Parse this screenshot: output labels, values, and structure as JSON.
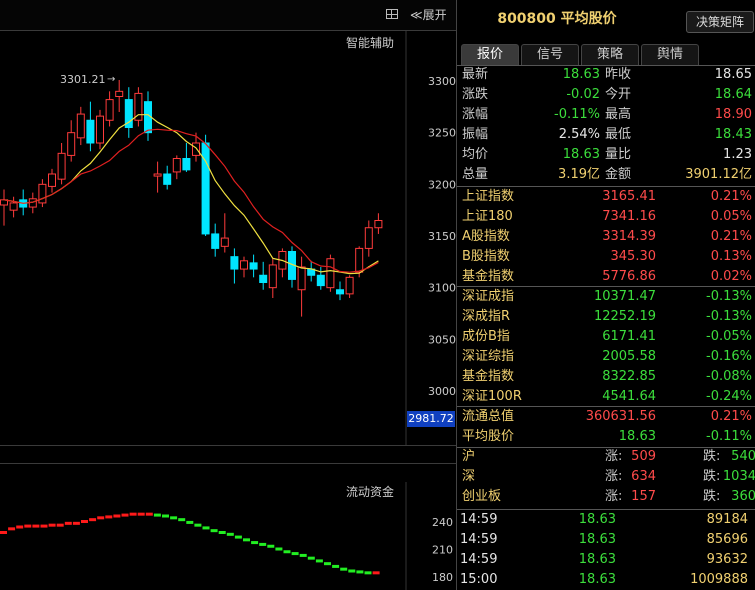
{
  "toolbar": {
    "expand_label": "≪展开"
  },
  "kline": {
    "indicator_label": "智能辅助",
    "high_label": "3301.21",
    "price_marker": "2981.72",
    "y_ticks": [
      "3300",
      "3250",
      "3200",
      "3150",
      "3100",
      "3050",
      "3000"
    ],
    "candles": [
      {
        "o": 3180,
        "h": 3195,
        "l": 3160,
        "c": 3185
      },
      {
        "o": 3175,
        "h": 3188,
        "l": 3168,
        "c": 3182
      },
      {
        "o": 3185,
        "h": 3195,
        "l": 3170,
        "c": 3178
      },
      {
        "o": 3178,
        "h": 3192,
        "l": 3172,
        "c": 3186
      },
      {
        "o": 3182,
        "h": 3205,
        "l": 3178,
        "c": 3200
      },
      {
        "o": 3198,
        "h": 3215,
        "l": 3192,
        "c": 3210
      },
      {
        "o": 3205,
        "h": 3240,
        "l": 3200,
        "c": 3230
      },
      {
        "o": 3228,
        "h": 3262,
        "l": 3222,
        "c": 3250
      },
      {
        "o": 3245,
        "h": 3275,
        "l": 3238,
        "c": 3268
      },
      {
        "o": 3262,
        "h": 3280,
        "l": 3232,
        "c": 3240
      },
      {
        "o": 3240,
        "h": 3272,
        "l": 3234,
        "c": 3266
      },
      {
        "o": 3262,
        "h": 3290,
        "l": 3256,
        "c": 3282
      },
      {
        "o": 3285,
        "h": 3301,
        "l": 3270,
        "c": 3290
      },
      {
        "o": 3282,
        "h": 3294,
        "l": 3245,
        "c": 3255
      },
      {
        "o": 3262,
        "h": 3294,
        "l": 3256,
        "c": 3288
      },
      {
        "o": 3280,
        "h": 3290,
        "l": 3242,
        "c": 3250
      },
      {
        "o": 3208,
        "h": 3222,
        "l": 3192,
        "c": 3210
      },
      {
        "o": 3210,
        "h": 3218,
        "l": 3195,
        "c": 3200
      },
      {
        "o": 3212,
        "h": 3228,
        "l": 3205,
        "c": 3225
      },
      {
        "o": 3225,
        "h": 3240,
        "l": 3212,
        "c": 3214
      },
      {
        "o": 3228,
        "h": 3250,
        "l": 3222,
        "c": 3240
      },
      {
        "o": 3240,
        "h": 3248,
        "l": 3150,
        "c": 3152
      },
      {
        "o": 3152,
        "h": 3162,
        "l": 3130,
        "c": 3138
      },
      {
        "o": 3140,
        "h": 3172,
        "l": 3134,
        "c": 3148
      },
      {
        "o": 3130,
        "h": 3138,
        "l": 3104,
        "c": 3118
      },
      {
        "o": 3118,
        "h": 3130,
        "l": 3110,
        "c": 3126
      },
      {
        "o": 3124,
        "h": 3132,
        "l": 3110,
        "c": 3118
      },
      {
        "o": 3112,
        "h": 3125,
        "l": 3098,
        "c": 3105
      },
      {
        "o": 3100,
        "h": 3128,
        "l": 3090,
        "c": 3122
      },
      {
        "o": 3118,
        "h": 3138,
        "l": 3110,
        "c": 3135
      },
      {
        "o": 3135,
        "h": 3140,
        "l": 3100,
        "c": 3108
      },
      {
        "o": 3098,
        "h": 3130,
        "l": 3072,
        "c": 3120
      },
      {
        "o": 3118,
        "h": 3126,
        "l": 3106,
        "c": 3112
      },
      {
        "o": 3112,
        "h": 3120,
        "l": 3098,
        "c": 3102
      },
      {
        "o": 3100,
        "h": 3132,
        "l": 3096,
        "c": 3128
      },
      {
        "o": 3098,
        "h": 3106,
        "l": 3088,
        "c": 3094
      },
      {
        "o": 3094,
        "h": 3112,
        "l": 3090,
        "c": 3110
      },
      {
        "o": 3115,
        "h": 3140,
        "l": 3110,
        "c": 3138
      },
      {
        "o": 3138,
        "h": 3165,
        "l": 3130,
        "c": 3158
      },
      {
        "o": 3158,
        "h": 3172,
        "l": 3152,
        "c": 3165
      }
    ]
  },
  "flow": {
    "label": "流动资金",
    "y_ticks": [
      "240",
      "210",
      "180"
    ],
    "bars": [
      228,
      232,
      234,
      235,
      235,
      235,
      236,
      236,
      238,
      238,
      240,
      242,
      244,
      245,
      246,
      247,
      248,
      248,
      248,
      247,
      246,
      244,
      242,
      239,
      236,
      233,
      230,
      228,
      226,
      223,
      220,
      217,
      215,
      213,
      210,
      207,
      205,
      203,
      200,
      197,
      194,
      191,
      188,
      186,
      185,
      184,
      184
    ]
  },
  "panel": {
    "code_name": "800800 平均股价",
    "decision_button": "决策矩阵",
    "tabs": [
      "报价",
      "信号",
      "策略",
      "舆情"
    ],
    "quote": [
      {
        "l1": "最新",
        "v1": "18.63",
        "c1": "green",
        "l2": "昨收",
        "v2": "18.65",
        "c2": "white"
      },
      {
        "l1": "涨跌",
        "v1": "-0.02",
        "c1": "green",
        "l2": "今开",
        "v2": "18.64",
        "c2": "green"
      },
      {
        "l1": "涨幅",
        "v1": "-0.11%",
        "c1": "green",
        "l2": "最高",
        "v2": "18.90",
        "c2": "red"
      },
      {
        "l1": "振幅",
        "v1": "2.54%",
        "c1": "white",
        "l2": "最低",
        "v2": "18.43",
        "c2": "green"
      },
      {
        "l1": "均价",
        "v1": "18.63",
        "c1": "green",
        "l2": "量比",
        "v2": "1.23",
        "c2": "white"
      },
      {
        "l1": "总量",
        "v1": "3.19亿",
        "c1": "yellow",
        "l2": "金额",
        "v2": "3901.12亿",
        "c2": "yellow"
      }
    ],
    "indices_sh": [
      {
        "name": "上证指数",
        "value": "3165.41",
        "vc": "red",
        "pct": "0.21%",
        "pc": "red"
      },
      {
        "name": "上证180",
        "value": "7341.16",
        "vc": "red",
        "pct": "0.05%",
        "pc": "red"
      },
      {
        "name": "A股指数",
        "value": "3314.39",
        "vc": "red",
        "pct": "0.21%",
        "pc": "red"
      },
      {
        "name": "B股指数",
        "value": "345.30",
        "vc": "red",
        "pct": "0.13%",
        "pc": "red"
      },
      {
        "name": "基金指数",
        "value": "5776.86",
        "vc": "red",
        "pct": "0.02%",
        "pc": "red"
      }
    ],
    "indices_sz": [
      {
        "name": "深证成指",
        "value": "10371.47",
        "vc": "green",
        "pct": "-0.13%",
        "pc": "green"
      },
      {
        "name": "深成指R",
        "value": "12252.19",
        "vc": "green",
        "pct": "-0.13%",
        "pc": "green"
      },
      {
        "name": "成份B指",
        "value": "6171.41",
        "vc": "green",
        "pct": "-0.05%",
        "pc": "green"
      },
      {
        "name": "深证综指",
        "value": "2005.58",
        "vc": "green",
        "pct": "-0.16%",
        "pc": "green"
      },
      {
        "name": "基金指数",
        "value": "8322.85",
        "vc": "green",
        "pct": "-0.08%",
        "pc": "green"
      },
      {
        "name": "深证100R",
        "value": "4541.64",
        "vc": "green",
        "pct": "-0.24%",
        "pc": "green"
      }
    ],
    "market": [
      {
        "name": "流通总值",
        "value": "360631.56",
        "vc": "red",
        "pct": "0.21%",
        "pc": "red"
      },
      {
        "name": "平均股价",
        "value": "18.63",
        "vc": "green",
        "pct": "-0.11%",
        "pc": "green"
      }
    ],
    "breadth": [
      {
        "name": "沪",
        "up_label": "涨:",
        "up": "509",
        "down_label": "跌:",
        "down": "540"
      },
      {
        "name": "深",
        "up_label": "涨:",
        "up": "634",
        "down_label": "跌:",
        "down": "1034"
      },
      {
        "name": "创业板",
        "up_label": "涨:",
        "up": "157",
        "down_label": "跌:",
        "down": "360"
      }
    ],
    "ticks": [
      {
        "time": "14:59",
        "price": "18.63",
        "vol": "89184"
      },
      {
        "time": "14:59",
        "price": "18.63",
        "vol": "85696"
      },
      {
        "time": "14:59",
        "price": "18.63",
        "vol": "93632"
      },
      {
        "time": "15:00",
        "price": "18.63",
        "vol": "1009888"
      }
    ]
  },
  "colors": {
    "up": "#ff3b3b",
    "down": "#00e5ff",
    "ma1": "#f0e040",
    "ma2": "#e02020",
    "flow_up": "#ff1a1a",
    "flow_down": "#22ee22"
  }
}
